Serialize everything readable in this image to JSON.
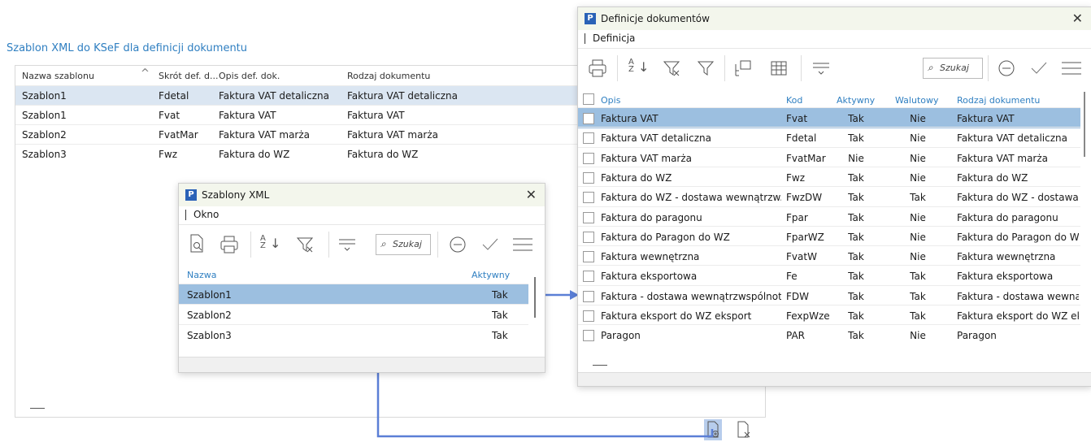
{
  "main": {
    "title": "Szablon XML do KSeF dla definicji dokumentu",
    "columns": [
      "Nazwa szablonu",
      "Skrót def. d...",
      "Opis def. dok.",
      "Rodzaj dokumentu"
    ],
    "rows": [
      [
        "Szablon1",
        "Fdetal",
        "Faktura VAT detaliczna",
        "Faktura VAT detaliczna"
      ],
      [
        "Szablon1",
        "Fvat",
        "Faktura VAT",
        "Faktura VAT"
      ],
      [
        "Szablon2",
        "FvatMar",
        "Faktura VAT marża",
        "Faktura VAT marża"
      ],
      [
        "Szablon3",
        "Fwz",
        "Faktura do WZ",
        "Faktura do WZ"
      ]
    ]
  },
  "szablony": {
    "title": "Szablony XML",
    "menu": "Okno",
    "search_placeholder": "Szukaj",
    "columns": [
      "Nazwa",
      "Aktywny"
    ],
    "rows": [
      [
        "Szablon1",
        "Tak"
      ],
      [
        "Szablon2",
        "Tak"
      ],
      [
        "Szablon3",
        "Tak"
      ]
    ]
  },
  "definicje": {
    "title": "Definicje dokumentów",
    "menu": "Definicja",
    "search_placeholder": "Szukaj",
    "columns": [
      "Opis",
      "Kod",
      "Aktywny",
      "Walutowy",
      "Rodzaj dokumentu"
    ],
    "rows": [
      [
        "Faktura VAT",
        "Fvat",
        "Tak",
        "Nie",
        "Faktura VAT"
      ],
      [
        "Faktura VAT detaliczna",
        "Fdetal",
        "Tak",
        "Nie",
        "Faktura VAT detaliczna"
      ],
      [
        "Faktura VAT marża",
        "FvatMar",
        "Nie",
        "Nie",
        "Faktura VAT marża"
      ],
      [
        "Faktura do WZ",
        "Fwz",
        "Tak",
        "Nie",
        "Faktura do WZ"
      ],
      [
        "Faktura do WZ - dostawa wewnątrzw...",
        "FwzDW",
        "Tak",
        "Tak",
        "Faktura do WZ - dostawa"
      ],
      [
        "Faktura do paragonu",
        "Fpar",
        "Tak",
        "Nie",
        "Faktura do paragonu"
      ],
      [
        "Faktura do Paragon do WZ",
        "FparWZ",
        "Tak",
        "Nie",
        "Faktura do Paragon do W"
      ],
      [
        "Faktura wewnętrzna",
        "FvatW",
        "Tak",
        "Nie",
        "Faktura wewnętrzna"
      ],
      [
        "Faktura eksportowa",
        "Fe",
        "Tak",
        "Tak",
        "Faktura eksportowa"
      ],
      [
        "Faktura - dostawa wewnątrzwspólnot...",
        "FDW",
        "Tak",
        "Tak",
        "Faktura - dostawa wewnąt"
      ],
      [
        "Faktura eksport do WZ eksport",
        "FexpWze",
        "Tak",
        "Tak",
        "Faktura eksport do WZ ek"
      ],
      [
        "Paragon",
        "PAR",
        "Tak",
        "Nie",
        "Paragon"
      ]
    ]
  },
  "colors": {
    "accent": "#2f7fc1",
    "arrow": "#5b7fd6",
    "selection": "#9cbfe0"
  },
  "icons": [
    "add-document-icon",
    "remove-document-icon",
    "print-icon",
    "sort-az-icon",
    "filter-icon",
    "search-icon"
  ]
}
